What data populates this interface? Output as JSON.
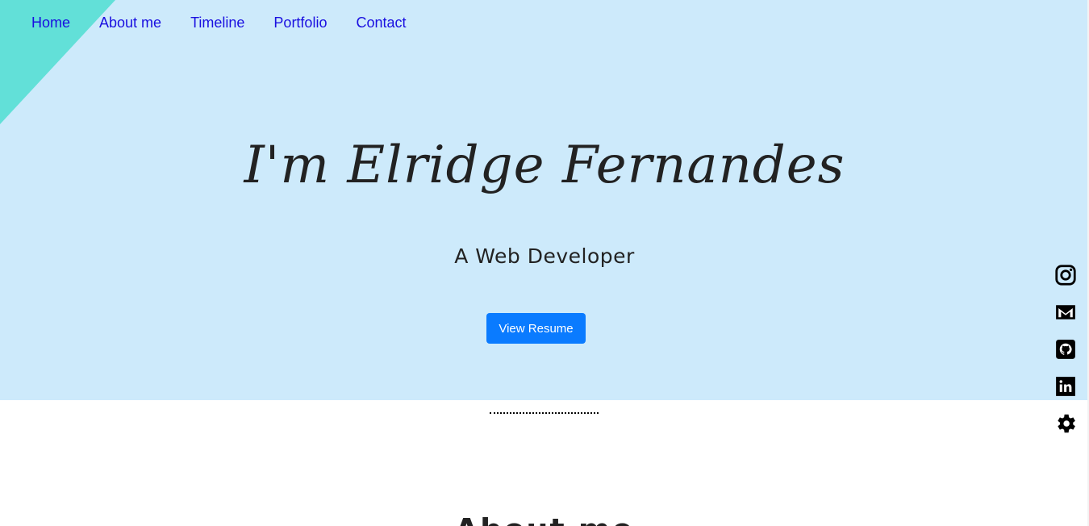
{
  "nav": {
    "items": [
      {
        "label": "Home"
      },
      {
        "label": "About me"
      },
      {
        "label": "Timeline"
      },
      {
        "label": "Portfolio"
      },
      {
        "label": "Contact"
      }
    ],
    "link_color": "#1a0fe0"
  },
  "hero": {
    "title": "I'm Elridge Fernandes",
    "subtitle": "A Web Developer",
    "button_label": "View Resume",
    "background_color": "#cdeafb",
    "accent_triangle_color": "#62e0d8",
    "button_color": "#0a7bff"
  },
  "about": {
    "heading": "About me"
  },
  "social": {
    "icons": [
      "instagram-icon",
      "gmail-icon",
      "github-icon",
      "linkedin-icon",
      "gear-icon"
    ]
  }
}
